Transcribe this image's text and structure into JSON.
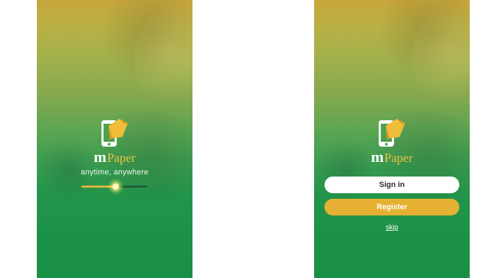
{
  "colors": {
    "brand_green": "#1a9046",
    "brand_gold": "#e6b132",
    "top_gold": "#c9a63b"
  },
  "splash_screen": {
    "logo": {
      "prefix": "m",
      "suffix": "Paper",
      "icon": "phone-with-paper-icon"
    },
    "tagline": "anytime, anywhere",
    "loading_progress": 0.52
  },
  "welcome_screen": {
    "logo": {
      "prefix": "m",
      "suffix": "Paper",
      "icon": "phone-with-paper-icon"
    },
    "signin_label": "Sign in",
    "register_label": "Register",
    "skip_label": "skip"
  }
}
